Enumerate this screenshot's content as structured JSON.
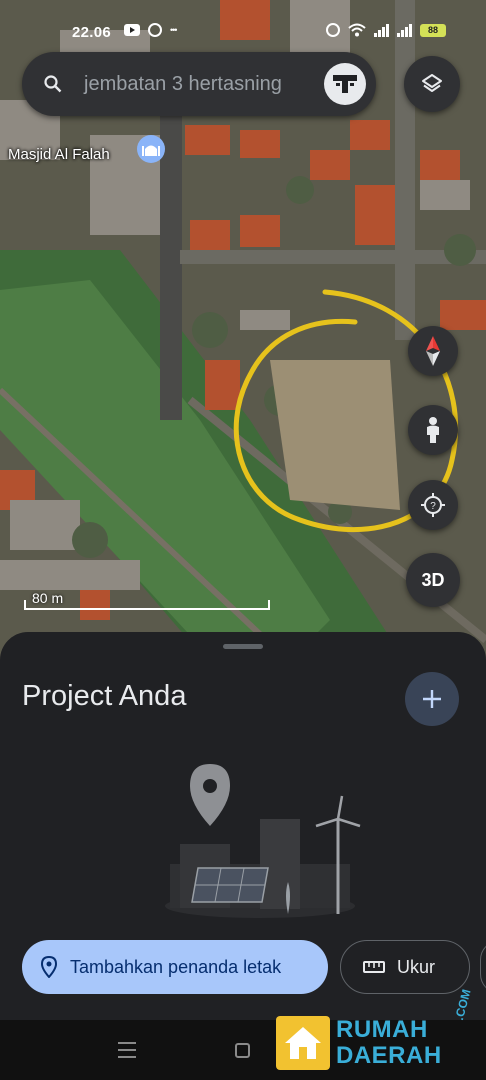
{
  "status_bar": {
    "time": "22.06",
    "battery": "88"
  },
  "search": {
    "query": "jembatan 3 hertasning"
  },
  "map": {
    "poi_label": "Masjid Al Falah",
    "scale_label": "80 m",
    "button_3d": "3D",
    "annotation_color": "#e6c21c"
  },
  "sheet": {
    "title": "Project Anda",
    "primary_action": "Tambahkan penanda letak",
    "secondary_action": "Ukur"
  },
  "watermark": {
    "line1": "RUMAH",
    "line2": "DAERAH",
    "suffix": ".COM"
  },
  "colors": {
    "sheet_bg": "#202124",
    "primary_chip": "#a8c7fa",
    "accent_blue": "#8ab4f8"
  }
}
